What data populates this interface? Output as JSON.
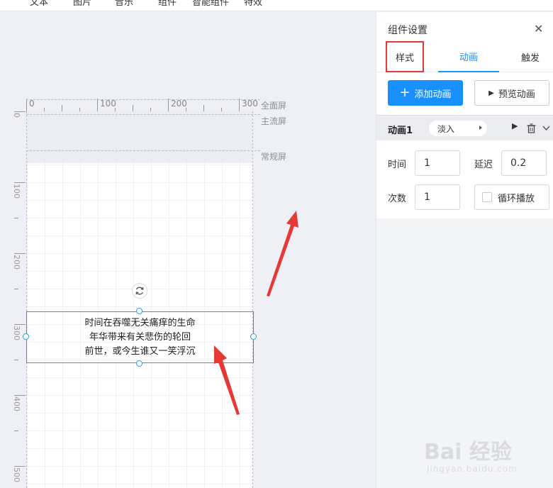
{
  "toolbar": {
    "items": [
      "文本",
      "图片",
      "音乐",
      "组件",
      "智能组件",
      "特效"
    ]
  },
  "ruler": {
    "top_labels": [
      "0",
      "100",
      "200",
      "300"
    ],
    "left_labels": [
      "0",
      "100",
      "200",
      "300",
      "400",
      "500"
    ]
  },
  "screens": {
    "full": "全面屏",
    "main": "主流屏",
    "normal": "常规屏"
  },
  "textbox": {
    "lines": [
      "时间在吞噬无关痛痒的生命",
      "年华带来有关悲伤的轮回",
      "前世，或今生谁又一笑浮沉"
    ]
  },
  "panel": {
    "title": "组件设置",
    "tabs": [
      {
        "label": "样式",
        "highlighted": true
      },
      {
        "label": "动画",
        "active": true
      },
      {
        "label": "触发"
      }
    ],
    "add_button": "添加动画",
    "preview_button": "预览动画",
    "animation": {
      "name": "动画1",
      "effect": "淡入"
    },
    "fields": {
      "time_label": "时间",
      "time_value": "1",
      "delay_label": "延迟",
      "delay_value": "0.2",
      "count_label": "次数",
      "count_value": "1",
      "loop_label": "循环播放"
    }
  },
  "watermark": {
    "brand": "Bai 经验",
    "url": "jingyan.baidu.com"
  },
  "colors": {
    "accent": "#1890ff",
    "selection": "#2a9bd8",
    "annotation_red": "#e53935"
  }
}
